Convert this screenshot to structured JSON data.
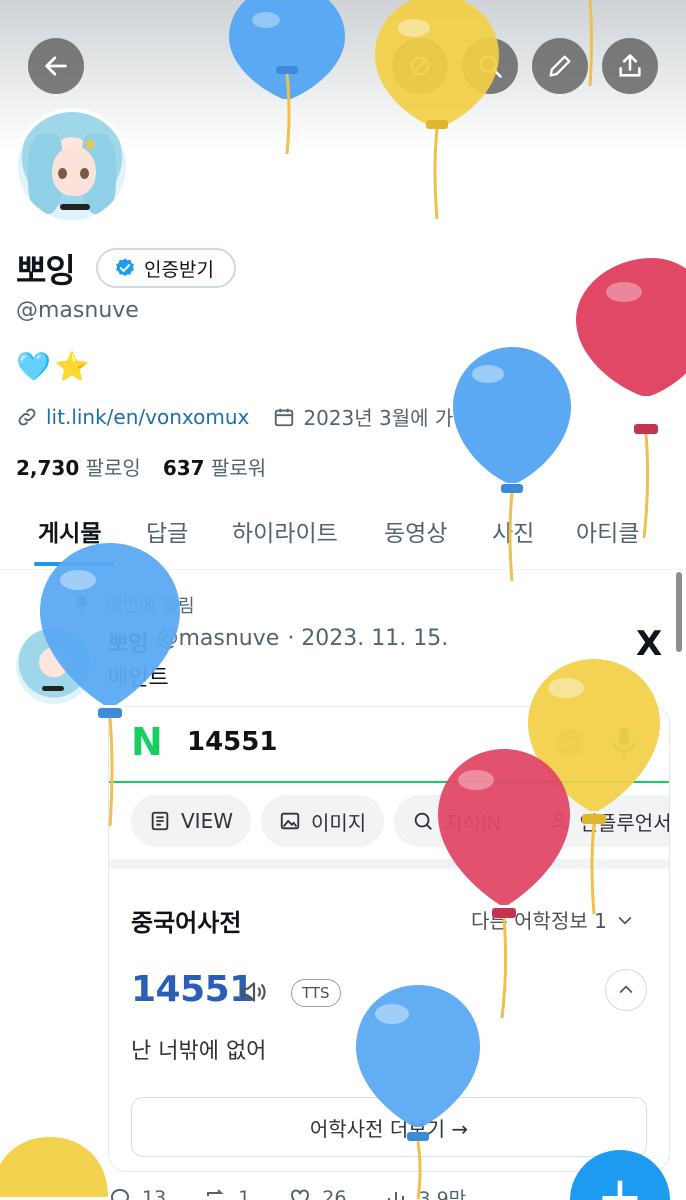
{
  "header": {
    "back_icon": "arrow-left-icon",
    "actions": [
      "mute-icon",
      "search-icon",
      "edit-icon",
      "share-icon"
    ]
  },
  "profile": {
    "display_name": "뽀잉",
    "verify_label": "인증받기",
    "handle": "@masnuve",
    "bio_emoji": [
      "🩵",
      "⭐"
    ],
    "link": "lit.link/en/vonxomux",
    "joined": "2023년 3월에 가입함",
    "following_count": "2,730",
    "following_label": "팔로잉",
    "followers_count": "637",
    "followers_label": "팔로워"
  },
  "tabs": [
    "게시물",
    "답글",
    "하이라이트",
    "동영상",
    "사진",
    "아티클"
  ],
  "active_tab": "게시물",
  "post": {
    "pinned_label": "메인에 올림",
    "author_name": "뽀잉",
    "author_handle": "@masnuve",
    "date": "· 2023. 11. 15.",
    "text": "메인트",
    "platform_logo": "X",
    "embed": {
      "search_query": "14551",
      "search_brand": "N",
      "chips": [
        "VIEW",
        "이미지",
        "지식iN",
        "인플루언서"
      ],
      "dict_title": "중국어사전",
      "dict_more": "다른 어학정보 1",
      "word": "14551",
      "tts_label": "TTS",
      "meaning": "난 너밖에 없어",
      "more_button": "어학사전 더보기 →"
    },
    "stats": {
      "replies": "13",
      "reposts": "1",
      "likes": "26",
      "views": "3.9만"
    }
  },
  "colors": {
    "accent": "#1d9bf0",
    "naver_green": "#19ce60",
    "balloon_blue": "#5aa9f2",
    "balloon_yellow": "#f3cf45",
    "balloon_red": "#e04866"
  }
}
